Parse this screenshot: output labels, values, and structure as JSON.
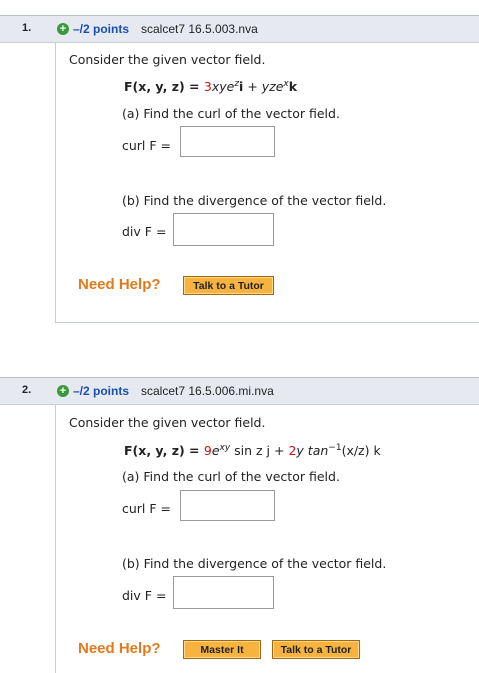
{
  "questions": [
    {
      "number": "1.",
      "points": "–/2 points",
      "source": "scalcet7 16.5.003.nva",
      "prompt": "Consider the given vector field.",
      "field": {
        "lhs": "F(x, y, z) = ",
        "c1": "3",
        "t1a": "xye",
        "t1sup": "z",
        "t1b": "i",
        "plus1": " + ",
        "t2a": "yze",
        "t2sup": "x",
        "t2b": "k"
      },
      "part_a": "(a) Find the curl of the vector field.",
      "curl_label": "curl F =",
      "part_b": "(b) Find the divergence of the vector field.",
      "div_label": "div F =",
      "need_help": "Need Help?",
      "buttons": [
        "Talk to a Tutor"
      ]
    },
    {
      "number": "2.",
      "points": "–/2 points",
      "source": "scalcet7 16.5.006.mi.nva",
      "prompt": "Consider the given vector field.",
      "field": {
        "lhs": "F(x, y, z) = ",
        "c1": "9",
        "t1a": "e",
        "t1sup": "xy",
        "t1b": " sin z j",
        "plus1": " + ",
        "c2": "2",
        "t2a": "y tan",
        "t2sup": "−1",
        "t2b": "(x/z) k"
      },
      "part_a": "(a) Find the curl of the vector field.",
      "curl_label": "curl F =",
      "part_b": "(b) Find the divergence of the vector field.",
      "div_label": "div F =",
      "need_help": "Need Help?",
      "buttons": [
        "Master It",
        "Talk to a Tutor"
      ]
    }
  ],
  "colors": {
    "accent": "#e27a1c",
    "points": "#1a4fb0",
    "coef": "#d01010",
    "button": "#f7b340"
  }
}
